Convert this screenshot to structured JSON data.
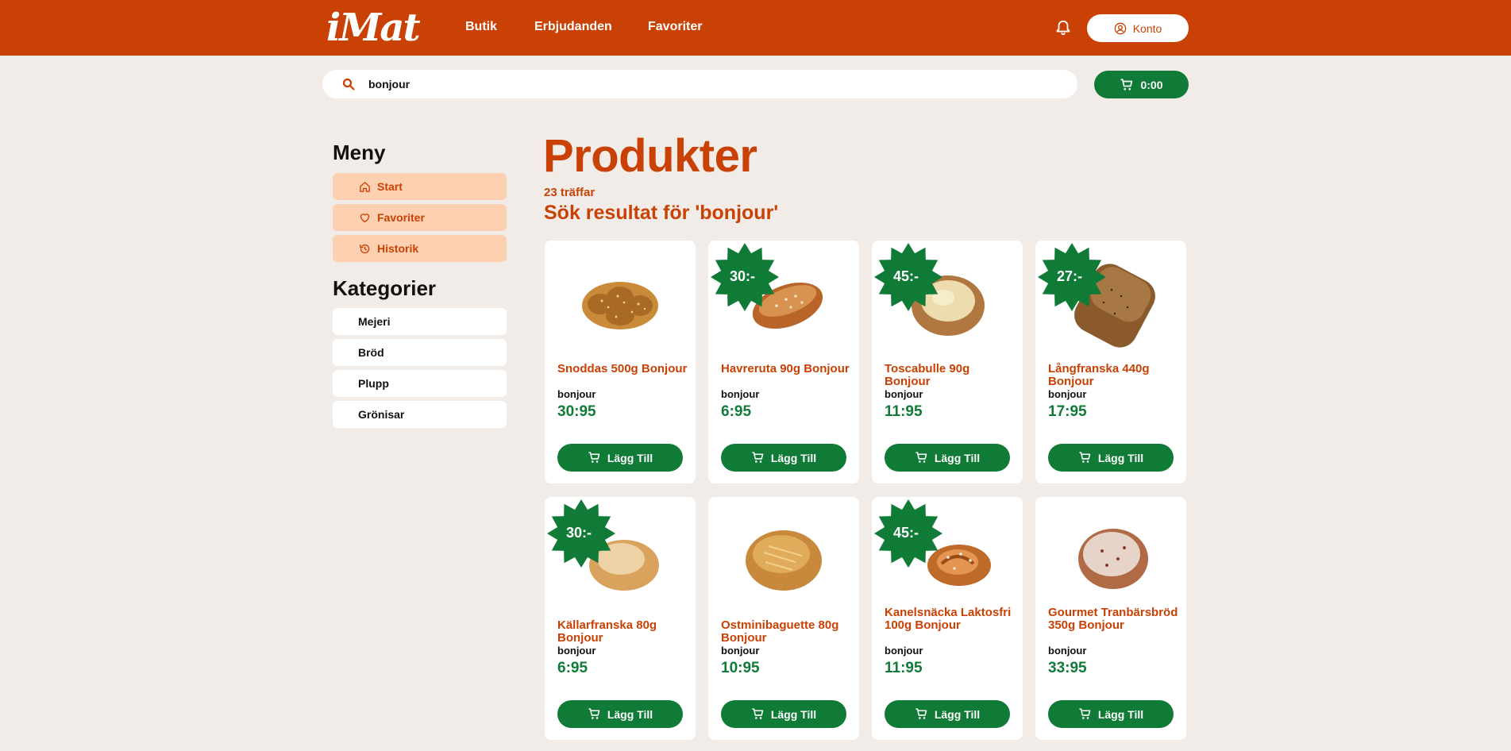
{
  "header": {
    "logo": "iMat",
    "nav": [
      "Butik",
      "Erbjudanden",
      "Favoriter"
    ],
    "account_label": "Konto"
  },
  "search": {
    "value": "bonjour",
    "placeholder": ""
  },
  "cart": {
    "total": "0:00"
  },
  "sidebar": {
    "menu_title": "Meny",
    "menu": [
      {
        "label": "Start",
        "icon": "home-icon"
      },
      {
        "label": "Favoriter",
        "icon": "heart-icon"
      },
      {
        "label": "Historik",
        "icon": "history-icon"
      }
    ],
    "categories_title": "Kategorier",
    "categories": [
      "Mejeri",
      "Bröd",
      "Plupp",
      "Grönisar"
    ]
  },
  "main": {
    "title": "Produkter",
    "hits": "23 träffar",
    "result_heading": "Sök resultat för 'bonjour'",
    "add_label": "Lägg Till",
    "products": [
      {
        "name": "Snoddas 500g Bonjour",
        "brand": "bonjour",
        "price": "30:95",
        "offer": ""
      },
      {
        "name": "Havreruta 90g Bonjour",
        "brand": "bonjour",
        "price": "6:95",
        "offer": "30:-"
      },
      {
        "name": "Toscabulle 90g Bonjour",
        "brand": "bonjour",
        "price": "11:95",
        "offer": "45:-"
      },
      {
        "name": "Långfranska 440g Bonjour",
        "brand": "bonjour",
        "price": "17:95",
        "offer": "27:-"
      },
      {
        "name": "Källarfranska 80g Bonjour",
        "brand": "bonjour",
        "price": "6:95",
        "offer": "30:-"
      },
      {
        "name": "Ostminibaguette 80g Bonjour",
        "brand": "bonjour",
        "price": "10:95",
        "offer": ""
      },
      {
        "name": "Kanelsnäcka Laktosfri 100g Bonjour",
        "brand": "bonjour",
        "price": "11:95",
        "offer": "45:-"
      },
      {
        "name": "Gourmet Tranbärsbröd 350g Bonjour",
        "brand": "bonjour",
        "price": "33:95",
        "offer": ""
      }
    ]
  },
  "colors": {
    "brand": "#c94104",
    "accent_green": "#107a37",
    "menu_bg": "#fdd0b1",
    "page_bg": "#f1ece8"
  }
}
